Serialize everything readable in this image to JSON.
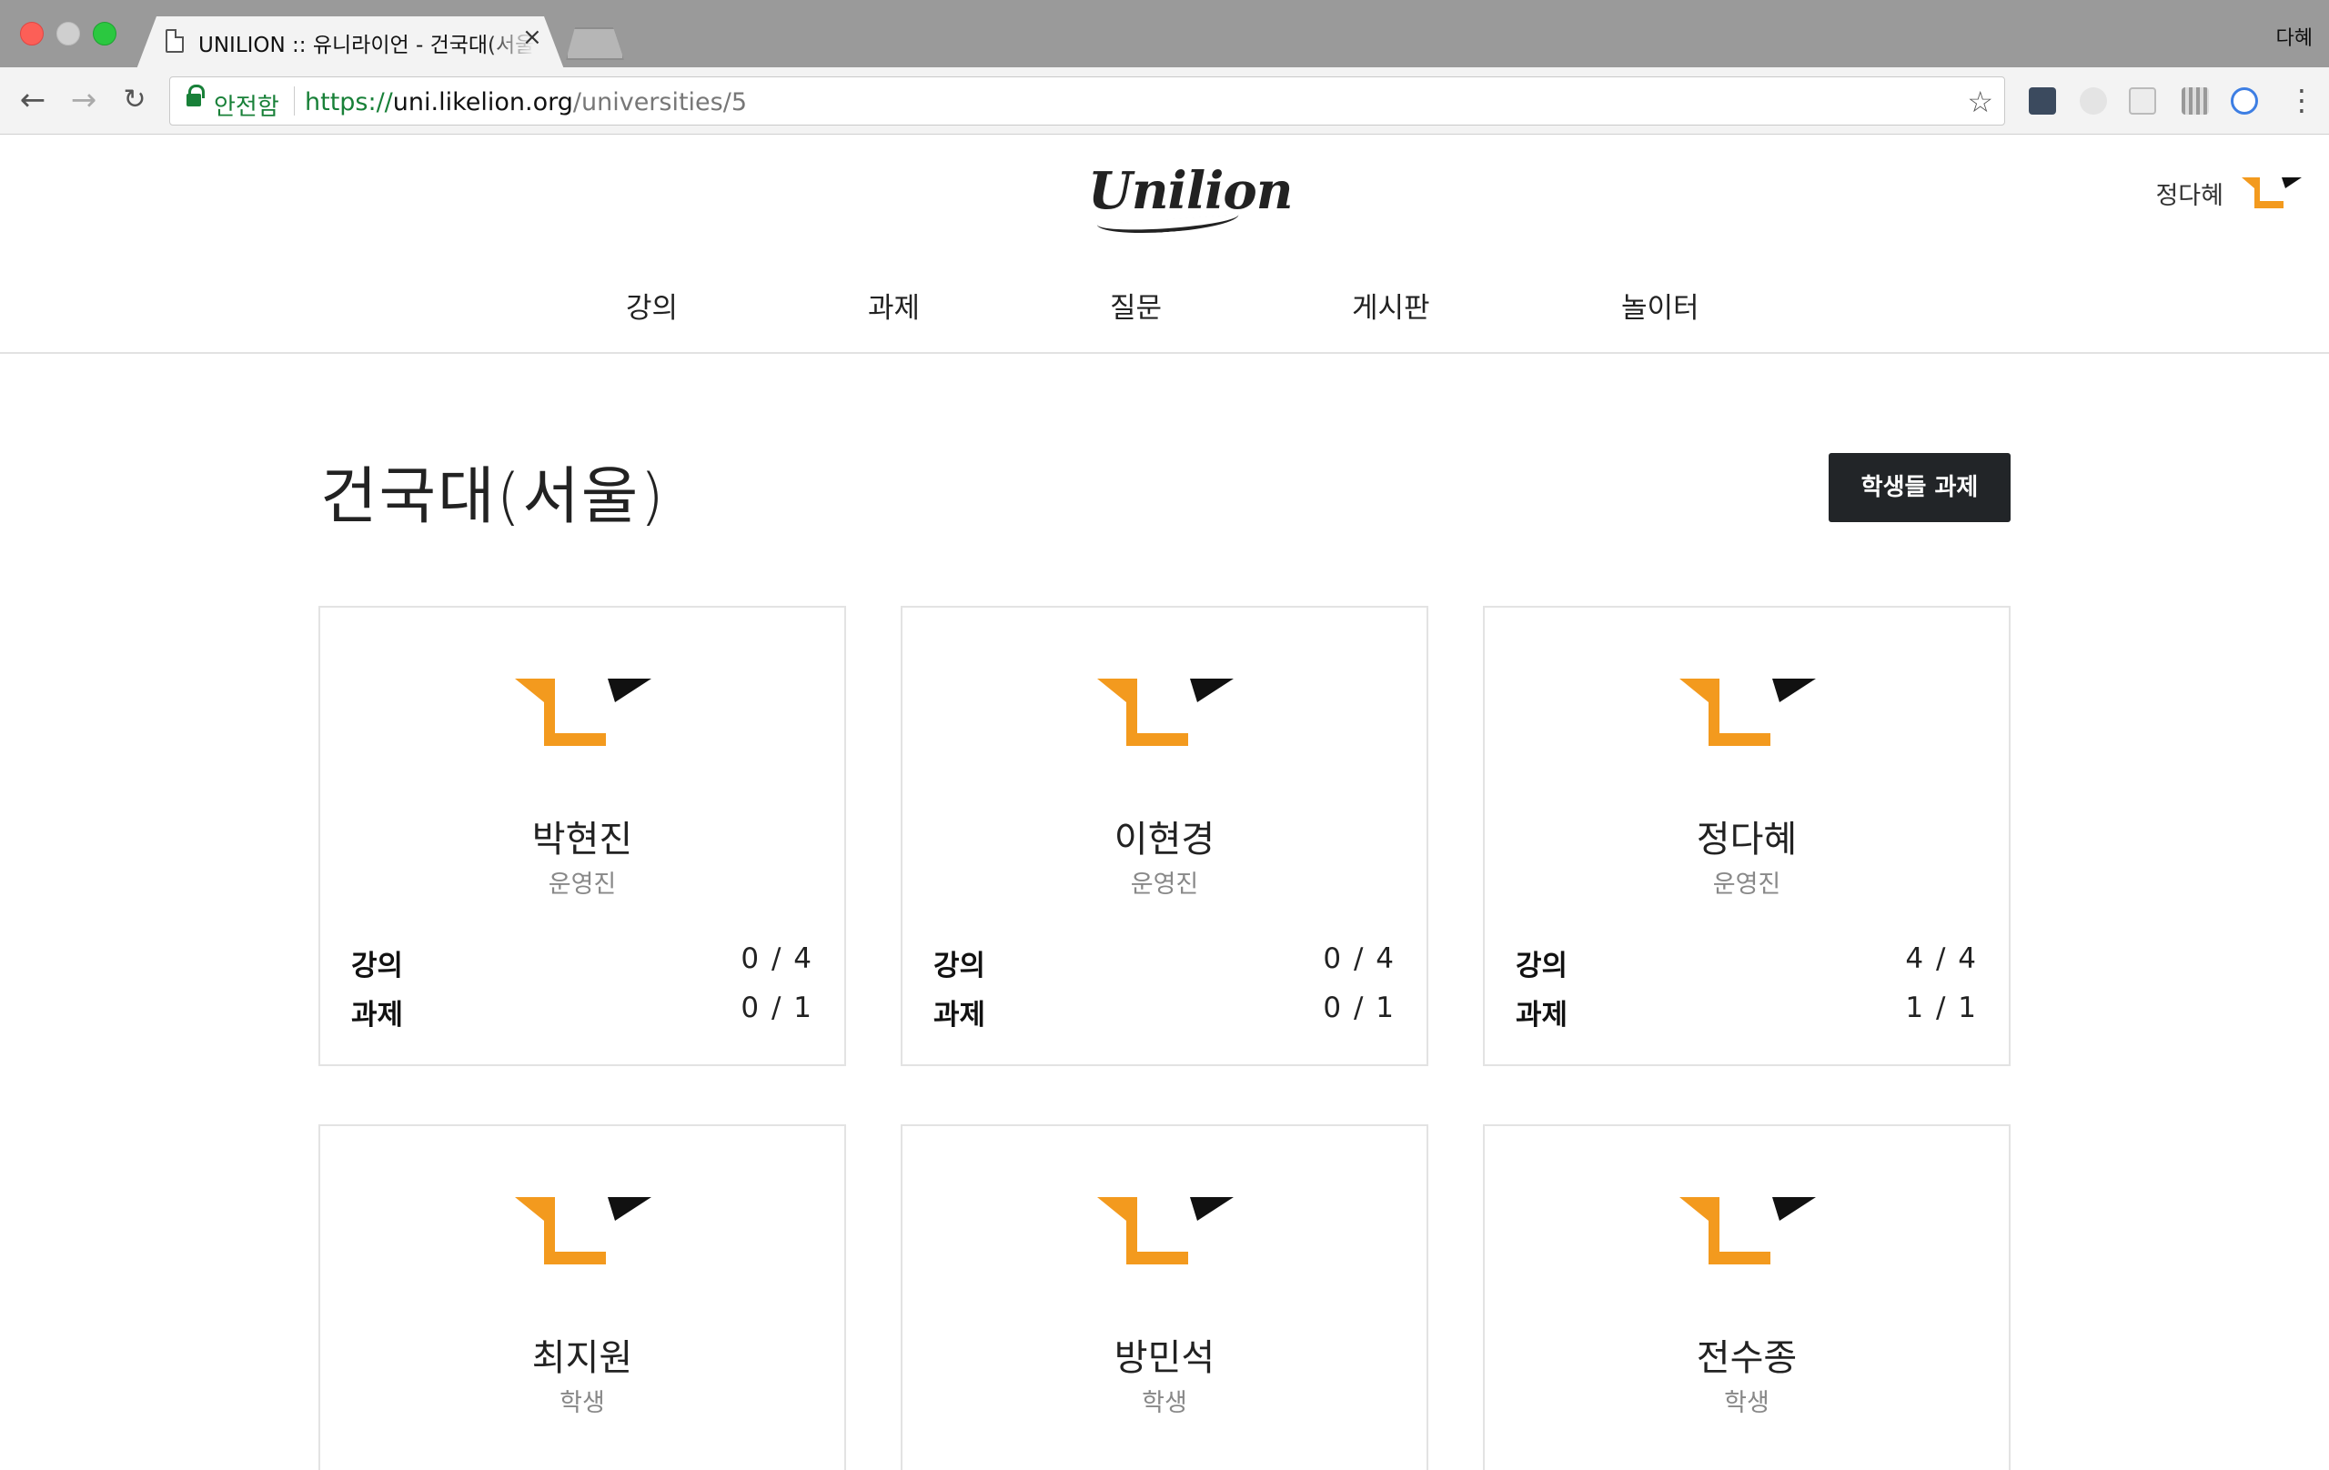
{
  "browser": {
    "tab_title": "UNILION :: 유니라이언 - 건국대(서울)",
    "profile": "다혜",
    "secure_label": "안전함",
    "url_scheme": "https://",
    "url_host": "uni.likelion.org",
    "url_path": "/universities/5"
  },
  "site": {
    "logo": "Unilion",
    "user_name": "정다혜",
    "nav": [
      "강의",
      "과제",
      "질문",
      "게시판",
      "놀이터"
    ]
  },
  "page": {
    "title": "건국대(서울)",
    "button_label": "학생들 과제"
  },
  "labels": {
    "lectures": "강의",
    "assignments": "과제"
  },
  "members": [
    {
      "name": "박현진",
      "role": "운영진",
      "lectures": "0 / 4",
      "assignments": "0 / 1"
    },
    {
      "name": "이현경",
      "role": "운영진",
      "lectures": "0 / 4",
      "assignments": "0 / 1"
    },
    {
      "name": "정다혜",
      "role": "운영진",
      "lectures": "4 / 4",
      "assignments": "1 / 1"
    },
    {
      "name": "최지원",
      "role": "학생"
    },
    {
      "name": "방민석",
      "role": "학생"
    },
    {
      "name": "전수종",
      "role": "학생"
    }
  ],
  "colors": {
    "brand_orange": "#f39a1e",
    "dark": "#222528"
  }
}
